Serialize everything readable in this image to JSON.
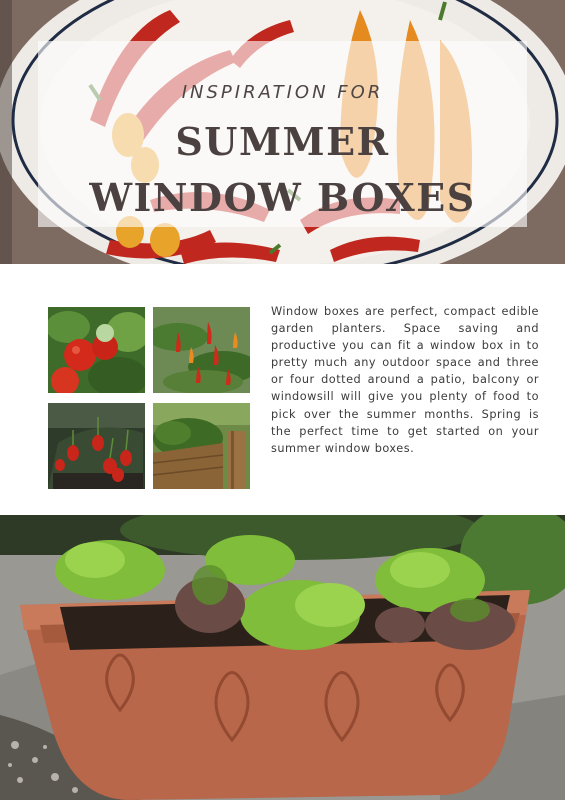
{
  "hero": {
    "kicker": "INSPIRATION FOR",
    "title": "SUMMER\nWINDOW BOXES",
    "image": "chilli-peppers-in-bowl-photo"
  },
  "thumbnails": [
    {
      "image": "cherry-tomatoes-photo"
    },
    {
      "image": "chilli-plant-photo"
    },
    {
      "image": "strawberries-window-box-photo"
    },
    {
      "image": "herbs-wooden-planter-photo"
    }
  ],
  "intro": {
    "text": "Window boxes are perfect, compact edible garden planters. Space saving and productive you can fit a window box in to pretty much any outdoor space and three or four dotted around a patio, balcony or windowsill will give you plenty of food to pick over the summer months. Spring is the perfect time to get started on your summer window boxes."
  },
  "bottom_photo": {
    "image": "lettuce-terracotta-window-box-photo"
  },
  "colors": {
    "title_text": "#4b4140",
    "body_text": "#3b3b3b",
    "terracotta": "#b8674a",
    "chilli_red": "#c0271e",
    "pepper_orange": "#e5891f"
  }
}
